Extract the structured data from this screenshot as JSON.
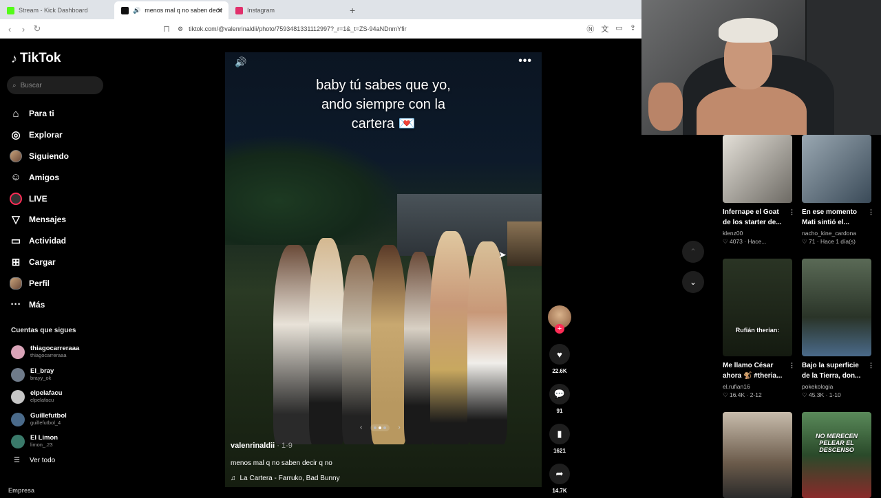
{
  "browser": {
    "tabs": [
      {
        "title": "Stream - Kick Dashboard",
        "color": "#53fc18"
      },
      {
        "title": "menos mal q no saben decir",
        "color": "#000000"
      },
      {
        "title": "Instagram",
        "color": "#e1306c"
      }
    ],
    "new_tab": "+",
    "url": "tiktok.com/@valenrinaldii/photo/7593481331112997?_r=1&_t=ZS-94aNDnmYfir"
  },
  "tiktok": {
    "brand": "TikTok",
    "search_placeholder": "Buscar",
    "menu": [
      {
        "label": "Para ti",
        "icon": "⌂"
      },
      {
        "label": "Explorar",
        "icon": "◎"
      },
      {
        "label": "Siguiendo",
        "icon": ""
      },
      {
        "label": "Amigos",
        "icon": "☺"
      },
      {
        "label": "LIVE",
        "icon": ""
      },
      {
        "label": "Mensajes",
        "icon": "▽"
      },
      {
        "label": "Actividad",
        "icon": "▭"
      },
      {
        "label": "Cargar",
        "icon": "⊞"
      },
      {
        "label": "Perfil",
        "icon": ""
      },
      {
        "label": "Más",
        "icon": "···"
      }
    ],
    "following_title": "Cuentas que sigues",
    "following": [
      {
        "name": "thiagocarreraaa",
        "handle": "thiagocarreraaa",
        "color": "#d9a4b8"
      },
      {
        "name": "El_bray",
        "handle": "brayy_ok",
        "color": "#6f7b8a"
      },
      {
        "name": "elpelafacu",
        "handle": "elpelafacu",
        "color": "#c6c6c6"
      },
      {
        "name": "Guillefutbol",
        "handle": "guillefutbol_4",
        "color": "#4a6a8a"
      },
      {
        "name": "El Limon",
        "handle": "limon_.23",
        "color": "#3a7a6a"
      }
    ],
    "see_all": "Ver todo",
    "company": "Empresa"
  },
  "post": {
    "overlay_text": "baby tú sabes que yo,\nando siempre con la\ncartera 💌",
    "author": "valenrinaldii",
    "date": " · 1-9",
    "description": "menos mal q no saben decir q no",
    "music": "La Cartera - Farruko, Bad Bunny",
    "likes": "22.6K",
    "comments": "91",
    "saves": "1621",
    "shares": "14.7K"
  },
  "recommendations": [
    {
      "title": "Infernape el Goat de los starter de...",
      "author": "klenz00",
      "stats": "♡ 4073 · Hace...",
      "thumb_top": "",
      "thumb_label": "",
      "bg": "#6d6a64"
    },
    {
      "title": "En ese momento Mati sintió el...",
      "author": "nacho_kine_cardona",
      "stats": "♡ 71 · Hace 1 día(s)",
      "thumb_top": "",
      "thumb_label": "",
      "bg": "#5a6c7a"
    },
    {
      "title": "Me llamo César ahora 🐒 #theria...",
      "author": "el.rufian16",
      "stats": "♡ 16.4K · 2-12",
      "thumb_top": "",
      "thumb_label": "Rufián therian:",
      "bg": "#20261c"
    },
    {
      "title": "Bajo la superficie de la Tierra, don...",
      "author": "pokekologia",
      "stats": "♡ 45.3K · 1-10",
      "thumb_top": "",
      "thumb_label": "",
      "bg": "#3d4a3a"
    },
    {
      "title": "",
      "author": "",
      "stats": "",
      "thumb_top": "",
      "thumb_label": "",
      "bg": "#8a7c6c"
    },
    {
      "title": "",
      "author": "",
      "stats": "",
      "thumb_top": "NO MERECEN PELEAR EL DESCENSO",
      "thumb_label": "",
      "bg": "#3a5a3a"
    }
  ]
}
